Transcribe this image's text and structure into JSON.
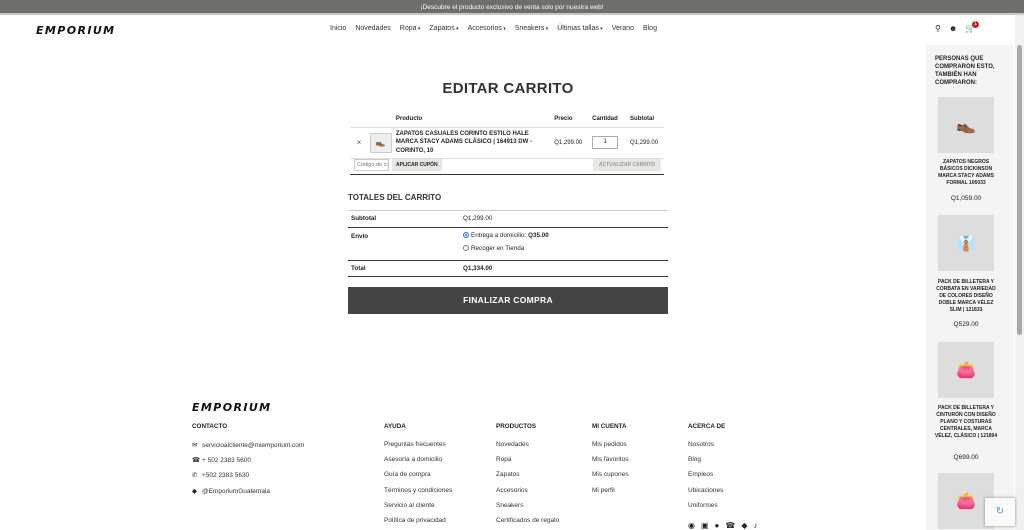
{
  "announcement": "¡Descubre el producto exclusivo de venta solo por nuestra web!",
  "header": {
    "logo": "EMPORIUM",
    "nav": [
      {
        "label": "Inicio"
      },
      {
        "label": "Novedades"
      },
      {
        "label": "Ropa"
      },
      {
        "label": "Zapatos"
      },
      {
        "label": "Accesorios"
      },
      {
        "label": "Sneakers"
      },
      {
        "label": "Últimas tallas"
      },
      {
        "label": "Verano"
      },
      {
        "label": "Blog"
      }
    ],
    "cart_count": "1"
  },
  "cart": {
    "title": "EDITAR CARRITO",
    "columns": [
      "Producto",
      "Precio",
      "Cantidad",
      "Subtotal"
    ],
    "items": [
      {
        "remove": "×",
        "name": "ZAPATOS CASUALES CORINTO ESTILO HALE MARCA STACY ADAMS CLÁSICO | 164913 DW - CORINTO, 10",
        "price": "Q1,299.00",
        "quantity": "1",
        "subtotal": "Q1,299.00"
      }
    ],
    "coupon_placeholder": "Código de cupón",
    "apply_coupon": "APLICAR CUPÓN",
    "update_cart": "ACTUALIZAR CARRITO"
  },
  "totals": {
    "title": "TOTALES DEL CARRITO",
    "subtotal_label": "Subtotal",
    "subtotal_value": "Q1,299.00",
    "shipping_label": "Envío",
    "shipping_option1": "Entrega a domicilio: ",
    "shipping_option1_price": "Q35.00",
    "shipping_option2": "Recoger en Tienda",
    "total_label": "Total",
    "total_value": "Q1,334.00",
    "checkout": "FINALIZAR COMPRA"
  },
  "footer": {
    "logo": "EMPORIUM",
    "contacto": {
      "title": "CONTACTO",
      "items": [
        "servicioalcliente@miemporium.com",
        "+ 502 2383 5600",
        "+502 2383 5630",
        "@EmporiumGuatemala"
      ]
    },
    "ayuda": {
      "title": "AYUDA",
      "items": [
        "Preguntas frecuentes",
        "Asesoría a domicilio",
        "Guía de compra",
        "Términos y condiciones",
        "Servicio al cliente",
        "Política de privacidad"
      ]
    },
    "productos": {
      "title": "PRODUCTOS",
      "items": [
        "Novedades",
        "Ropa",
        "Zapatos",
        "Accesorios",
        "Sneakers",
        "Certificados de regalo"
      ]
    },
    "micuenta": {
      "title": "MI CUENTA",
      "items": [
        "Mis pedidos",
        "Mis favoritos",
        "Mis cupones",
        "Mi perfil"
      ]
    },
    "acerca": {
      "title": "ACERCA DE",
      "items": [
        "Nosotros",
        "Blog",
        "Empleos",
        "Ubicaciones",
        "Uniformes"
      ]
    }
  },
  "sidebar": {
    "title": "PERSONAS QUE COMPRARON ESTO, TAMBIÉN HAN COMPRARON:",
    "products": [
      {
        "name": "ZAPATOS NEGROS BÁSICOS DICKINSON MARCA STACY ADAMS FORMAL 106033",
        "price": "Q1,059.00"
      },
      {
        "name": "PACK DE BILLETERA Y CORBATA EN VARIEDAD DE COLORES DISEÑO DOBLE MARCA VÉLEZ SLIM | 121833",
        "price": "Q529.00"
      },
      {
        "name": "PACK DE BILLETERA Y CINTURÓN CON DISEÑO PLANO Y COSTURAS CENTRALES, MARCA VÉLEZ, CLÁSICO | 121894",
        "price": "Q699.00"
      }
    ]
  }
}
